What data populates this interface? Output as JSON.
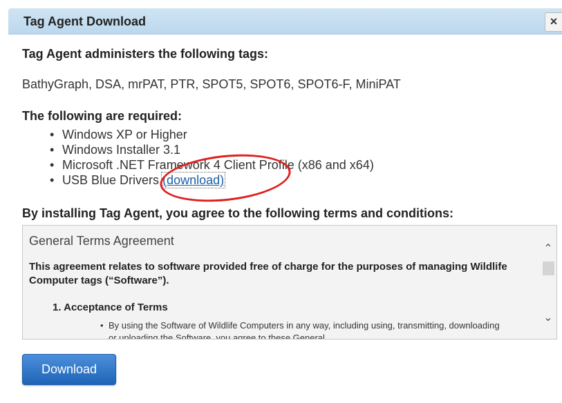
{
  "dialog": {
    "title": "Tag Agent Download",
    "close_label": "×"
  },
  "tags": {
    "heading": "Tag Agent administers the following tags:",
    "list": "BathyGraph, DSA, mrPAT, PTR, SPOT5, SPOT6, SPOT6-F, MiniPAT"
  },
  "requirements": {
    "heading": "The following are required:",
    "items": [
      "Windows XP or Higher",
      "Windows Installer 3.1",
      "Microsoft .NET Framework 4 Client Profile (x86 and x64)",
      "USB Blue Drivers"
    ],
    "download_link": "(download)"
  },
  "terms": {
    "heading": "By installing Tag Agent, you agree to the following terms and conditions:",
    "box_title": "General Terms Agreement",
    "intro": "This agreement relates to software provided free of charge for the purposes of managing Wildlife Computer tags (“Software”).",
    "section_1": "1.  Acceptance of Terms",
    "bullet_1": "By using the Software of Wildlife Computers in any way, including using, transmitting, downloading or uploading the Software, you agree to these General"
  },
  "actions": {
    "download_label": "Download"
  },
  "annotation_color": "#e01e1e",
  "icons": {
    "close": "close-icon",
    "scroll_up": "chevron-up-icon",
    "scroll_down": "chevron-down-icon"
  }
}
